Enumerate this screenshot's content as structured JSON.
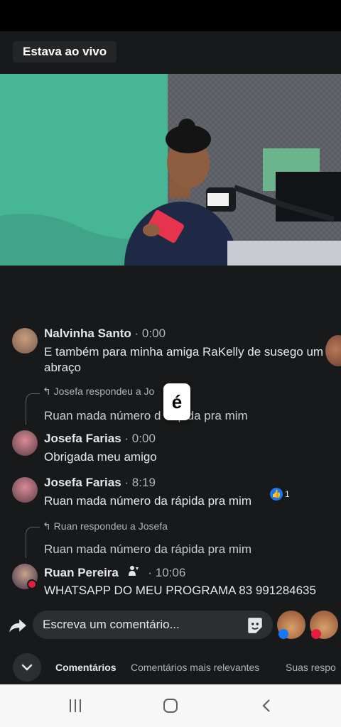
{
  "header": {
    "live_label": "Estava ao vivo"
  },
  "comments": [
    {
      "name": "Nalvinha Santo",
      "time": "· 0:00",
      "text": "E também para minha amiga RaKelly de susego um abraço"
    },
    {
      "reply_label": "Josefa respondeu a Jo",
      "quote": "Ruan mada número d",
      "quote_tail": "pida pra mim"
    },
    {
      "name": "Josefa Farias",
      "time": "· 0:00",
      "text": "Obrigada meu amigo"
    },
    {
      "name": "Josefa Farias",
      "time": "· 8:19",
      "text": "Ruan mada número da rápida pra mim",
      "likes": "1"
    },
    {
      "reply_label": "Ruan respondeu a Josefa",
      "quote": "Ruan mada número da rápida pra mim"
    },
    {
      "name": "Ruan Pereira",
      "time": "· 10:06",
      "text": "WHATSAPP DO MEU PROGRAMA 83 991284635"
    }
  ],
  "keyboard_popup": "é",
  "composer": {
    "placeholder": "Escreva um comentário..."
  },
  "tabs": [
    {
      "label": "Comentários",
      "active": true
    },
    {
      "label": "Comentários mais relevantes",
      "active": false
    },
    {
      "label": "Suas respo",
      "active": false
    }
  ],
  "colors": {
    "background": "#18191a",
    "accent": "#1877f2",
    "input_bg": "#2d2e30",
    "text": "#e4e6eb",
    "muted": "#b0b3b8"
  },
  "icons": [
    "share-icon",
    "sticker-icon",
    "like-icon",
    "chevron-down-icon",
    "recents-icon",
    "home-icon",
    "back-icon"
  ]
}
